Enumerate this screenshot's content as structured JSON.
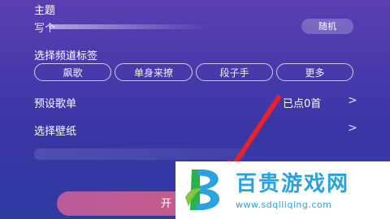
{
  "topic": {
    "label": "主题",
    "prefix": "写个",
    "random_label": "随机"
  },
  "channel_tags": {
    "label": "选择频道标签",
    "tags": [
      "飙歌",
      "单身来撩",
      "段子手",
      "更多"
    ]
  },
  "playlist": {
    "label": "预设歌单",
    "value": "已点0首"
  },
  "wallpaper": {
    "label": "选择壁纸"
  },
  "start_button": {
    "label": "开"
  },
  "watermark": {
    "title": "百贵游戏网",
    "url": "www.sdqlliqing.com"
  },
  "colors": {
    "background_top": "#5a3fb3",
    "background_bottom": "#2d3aa2",
    "arrow": "#e8212b",
    "start_button": "#d45d7b",
    "watermark_text": "#29a3df"
  },
  "icons": [
    "chevron-right-icon",
    "red-arrow-annotation",
    "watermark-logo"
  ]
}
